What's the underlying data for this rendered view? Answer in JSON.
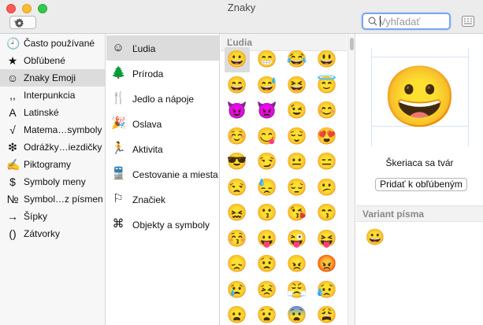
{
  "window": {
    "title": "Znaky"
  },
  "toolbar": {
    "search_placeholder": "Vyhľadať",
    "search_value": ""
  },
  "categories": [
    {
      "icon": "🕘",
      "icon_name": "clock-icon",
      "label": "Často používané",
      "selected": false
    },
    {
      "icon": "★",
      "icon_name": "star-icon",
      "label": "Obľúbené",
      "selected": false
    },
    {
      "icon": "☺",
      "icon_name": "smiley-icon",
      "label": "Znaky Emoji",
      "selected": true
    },
    {
      "icon": ",,",
      "icon_name": "punctuation-icon",
      "label": "Interpunkcia",
      "selected": false
    },
    {
      "icon": "A",
      "icon_name": "latin-letter-icon",
      "label": "Latinské",
      "selected": false
    },
    {
      "icon": "√",
      "icon_name": "square-root-icon",
      "label": "Matema…symboly",
      "selected": false
    },
    {
      "icon": "❇",
      "icon_name": "bullet-star-icon",
      "label": "Odrážky…iezdičky",
      "selected": false
    },
    {
      "icon": "✍",
      "icon_name": "pictograph-icon",
      "label": "Piktogramy",
      "selected": false
    },
    {
      "icon": "$",
      "icon_name": "dollar-icon",
      "label": "Symboly meny",
      "selected": false
    },
    {
      "icon": "№",
      "icon_name": "numero-icon",
      "label": "Symbol…z písmen",
      "selected": false
    },
    {
      "icon": "→",
      "icon_name": "arrow-right-icon",
      "label": "Šípky",
      "selected": false
    },
    {
      "icon": "()",
      "icon_name": "parentheses-icon",
      "label": "Zátvorky",
      "selected": false
    }
  ],
  "subcategories": [
    {
      "icon": "☺",
      "icon_name": "face-icon",
      "label": "Ľudia",
      "selected": true
    },
    {
      "icon": "🌲",
      "icon_name": "tree-icon",
      "label": "Príroda",
      "selected": false
    },
    {
      "icon": "🍴",
      "icon_name": "food-icon",
      "label": "Jedlo a nápoje",
      "selected": false
    },
    {
      "icon": "🎉",
      "icon_name": "party-popper-icon",
      "label": "Oslava",
      "selected": false
    },
    {
      "icon": "🏃",
      "icon_name": "runner-icon",
      "label": "Aktivita",
      "selected": false
    },
    {
      "icon": "🚆",
      "icon_name": "train-icon",
      "label": "Cestovanie a miesta",
      "selected": false
    },
    {
      "icon": "⚐",
      "icon_name": "flag-icon",
      "label": "Značiek",
      "selected": false
    },
    {
      "icon": "⌘",
      "icon_name": "objects-icon",
      "label": "Objekty a symboly",
      "selected": false
    }
  ],
  "emoji_grid": {
    "header": "Ľudia",
    "rows": [
      [
        "😀",
        "😁",
        "😂",
        "😃"
      ],
      [
        "😄",
        "😅",
        "😆",
        "😇"
      ],
      [
        "😈",
        "👿",
        "😉",
        "😊"
      ],
      [
        "☺️",
        "😋",
        "😌",
        "😍"
      ],
      [
        "😎",
        "😏",
        "😐",
        "😑"
      ],
      [
        "😒",
        "😓",
        "😔",
        "😕"
      ],
      [
        "😖",
        "😗",
        "😘",
        "😙"
      ],
      [
        "😚",
        "😛",
        "😜",
        "😝"
      ],
      [
        "😞",
        "😟",
        "😠",
        "😡"
      ],
      [
        "😢",
        "😣",
        "😤",
        "😥"
      ],
      [
        "😦",
        "😧",
        "😨",
        "😩"
      ]
    ],
    "selected": "😀"
  },
  "detail": {
    "preview": "😀",
    "name": "Škeriaca sa tvár",
    "add_favorite_label": "Pridať k obľúbeným",
    "variants_header": "Variant písma",
    "variants": [
      "😀"
    ]
  }
}
